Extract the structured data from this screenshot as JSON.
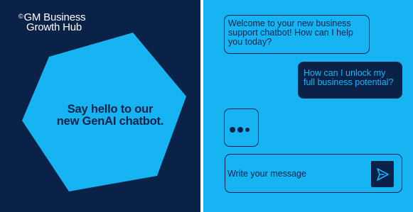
{
  "brand": {
    "logo_mark": "©",
    "name_line1": "GM Business",
    "name_line2": "Growth Hub"
  },
  "promo": {
    "tagline_line1": "Say hello to our",
    "tagline_line2": "new GenAI chatbot."
  },
  "chat": {
    "bot_message": {
      "line1": "Welcome to your new business",
      "line2": "support chatbot! How can I help",
      "line3": "you today?"
    },
    "user_message": {
      "line1": "How can I unlock my",
      "line2": "full business potential?"
    },
    "composer": {
      "placeholder": "Write your message",
      "send_icon": "send-arrow-icon"
    }
  },
  "colors": {
    "navy": "#0b2248",
    "sky_blue": "#17b4f4",
    "hexagon": "#17b4f4"
  }
}
